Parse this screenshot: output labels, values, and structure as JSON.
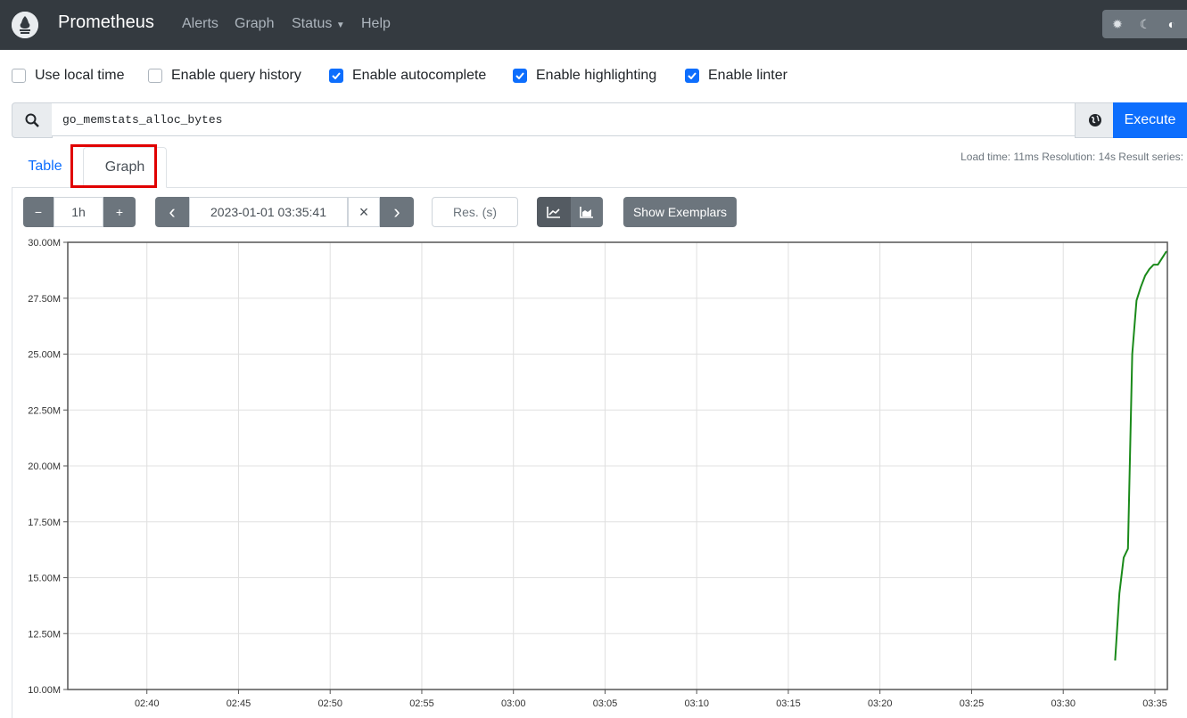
{
  "nav": {
    "brand": "Prometheus",
    "links": [
      "Alerts",
      "Graph",
      "Status",
      "Help"
    ]
  },
  "options": [
    {
      "label": "Use local time",
      "checked": false
    },
    {
      "label": "Enable query history",
      "checked": false
    },
    {
      "label": "Enable autocomplete",
      "checked": true
    },
    {
      "label": "Enable highlighting",
      "checked": true
    },
    {
      "label": "Enable linter",
      "checked": true
    }
  ],
  "query": {
    "expression": "go_memstats_alloc_bytes",
    "execute_label": "Execute"
  },
  "tabs": {
    "table": "Table",
    "graph": "Graph"
  },
  "stats": "Load time: 11ms   Resolution: 14s   Result series:",
  "controls": {
    "minus": "−",
    "range": "1h",
    "plus": "+",
    "prev": "‹",
    "end_time": "2023-01-01 03:35:41",
    "clear": "×",
    "next": "›",
    "resolution_placeholder": "Res. (s)",
    "show_exemplars": "Show Exemplars"
  },
  "colors": {
    "accent": "#0d6efd",
    "series": "#1a8a1a",
    "navbar": "#343a40"
  },
  "chart_data": {
    "type": "line",
    "title": "",
    "xlabel": "",
    "ylabel": "",
    "x_ticks": [
      "02:40",
      "02:45",
      "02:50",
      "02:55",
      "03:00",
      "03:05",
      "03:10",
      "03:15",
      "03:20",
      "03:25",
      "03:30",
      "03:35"
    ],
    "y_ticks": [
      "10.00M",
      "12.50M",
      "15.00M",
      "17.50M",
      "20.00M",
      "22.50M",
      "25.00M",
      "27.50M",
      "30.00M"
    ],
    "ylim": [
      10000000,
      30000000
    ],
    "xlim": [
      "02:35:41",
      "03:35:41"
    ],
    "grid": true,
    "series": [
      {
        "name": "go_memstats_alloc_bytes",
        "x": [
          "03:32:50",
          "03:33:04",
          "03:33:18",
          "03:33:32",
          "03:33:46",
          "03:34:00",
          "03:34:14",
          "03:34:28",
          "03:34:42",
          "03:34:56",
          "03:35:10",
          "03:35:24",
          "03:35:38"
        ],
        "values": [
          11300000,
          14300000,
          15900000,
          16300000,
          25000000,
          27400000,
          28000000,
          28500000,
          28800000,
          29000000,
          29000000,
          29300000,
          29600000
        ]
      }
    ]
  }
}
